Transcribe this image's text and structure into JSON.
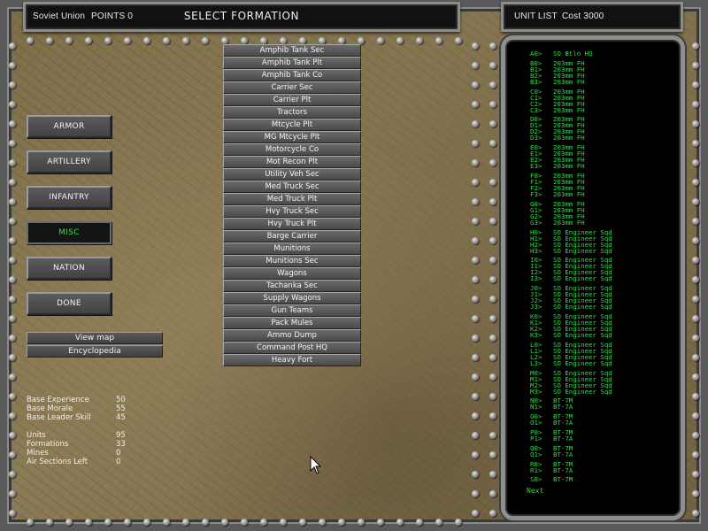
{
  "header": {
    "nation": "Soviet Union",
    "points_label": "POINTS 0",
    "title": "SELECT FORMATION",
    "unit_list_label": "UNIT LIST",
    "cost_label": "Cost 3000"
  },
  "menu": {
    "armor": "ARMOR",
    "artillery": "ARTILLERY",
    "infantry": "INFANTRY",
    "misc": "MISC",
    "nation": "NATION",
    "done": "DONE",
    "view_map": "View map",
    "encyclopedia": "Encyclopedia"
  },
  "formations": [
    "Amphib Tank Sec",
    "Amphib Tank Plt",
    "Amphib Tank Co",
    "Carrier Sec",
    "Carrier Plt",
    "Tractors",
    "Mtcycle Plt",
    "MG Mtcycle Plt",
    "Motorcycle Co",
    "Mot Recon Plt",
    "Utility Veh Sec",
    "Med Truck Sec",
    "Med Truck Plt",
    "Hvy Truck Sec",
    "Hvy Truck Plt",
    "Barge Carrier",
    "Munitions",
    "Munitions Sec",
    "Wagons",
    "Tachanka Sec",
    "Supply Wagons",
    "Gun Teams",
    "Pack Mules",
    "Ammo Dump",
    "Command Post HQ",
    "Heavy Fort"
  ],
  "stats": {
    "base_experience_label": "Base Experience",
    "base_experience": "50",
    "base_morale_label": "Base Morale",
    "base_morale": "55",
    "base_leader_label": "Base Leader Skill",
    "base_leader": "45",
    "units_label": "Units",
    "units": "95",
    "formations_label": "Formations",
    "formations": "33",
    "mines_label": "Mines",
    "mines": "0",
    "air_label": "Air Sections Left",
    "air": "0"
  },
  "unit_groups": [
    [
      {
        "code": "A0>",
        "name": "SO Btln HQ"
      }
    ],
    [
      {
        "code": "B0>",
        "name": "203mm FH"
      },
      {
        "code": "B1>",
        "name": "203mm FH"
      },
      {
        "code": "B2>",
        "name": "203mm FH"
      },
      {
        "code": "B3>",
        "name": "203mm FH"
      }
    ],
    [
      {
        "code": "C0>",
        "name": "203mm FH"
      },
      {
        "code": "C1>",
        "name": "203mm FH"
      },
      {
        "code": "C2>",
        "name": "203mm FH"
      },
      {
        "code": "C3>",
        "name": "203mm FH"
      }
    ],
    [
      {
        "code": "D0>",
        "name": "203mm FH"
      },
      {
        "code": "D1>",
        "name": "203mm FH"
      },
      {
        "code": "D2>",
        "name": "203mm FH"
      },
      {
        "code": "D3>",
        "name": "203mm FH"
      }
    ],
    [
      {
        "code": "E0>",
        "name": "203mm FH"
      },
      {
        "code": "E1>",
        "name": "203mm FH"
      },
      {
        "code": "E2>",
        "name": "203mm FH"
      },
      {
        "code": "E3>",
        "name": "203mm FH"
      }
    ],
    [
      {
        "code": "F0>",
        "name": "203mm FH"
      },
      {
        "code": "F1>",
        "name": "203mm FH"
      },
      {
        "code": "F2>",
        "name": "203mm FH"
      },
      {
        "code": "F3>",
        "name": "203mm FH"
      }
    ],
    [
      {
        "code": "G0>",
        "name": "203mm FH"
      },
      {
        "code": "G1>",
        "name": "203mm FH"
      },
      {
        "code": "G2>",
        "name": "203mm FH"
      },
      {
        "code": "G3>",
        "name": "203mm FH"
      }
    ],
    [
      {
        "code": "H0>",
        "name": "SO Engineer Sqd"
      },
      {
        "code": "H1>",
        "name": "SO Engineer Sqd"
      },
      {
        "code": "H2>",
        "name": "SO Engineer Sqd"
      },
      {
        "code": "H3>",
        "name": "SO Engineer Sqd"
      }
    ],
    [
      {
        "code": "I0>",
        "name": "SO Engineer Sqd"
      },
      {
        "code": "I1>",
        "name": "SO Engineer Sqd"
      },
      {
        "code": "I2>",
        "name": "SO Engineer Sqd"
      },
      {
        "code": "I3>",
        "name": "SO Engineer Sqd"
      }
    ],
    [
      {
        "code": "J0>",
        "name": "SO Engineer Sqd"
      },
      {
        "code": "J1>",
        "name": "SO Engineer Sqd"
      },
      {
        "code": "J2>",
        "name": "SO Engineer Sqd"
      },
      {
        "code": "J3>",
        "name": "SO Engineer Sqd"
      }
    ],
    [
      {
        "code": "K0>",
        "name": "SO Engineer Sqd"
      },
      {
        "code": "K1>",
        "name": "SO Engineer Sqd"
      },
      {
        "code": "K2>",
        "name": "SO Engineer Sqd"
      },
      {
        "code": "K3>",
        "name": "SO Engineer Sqd"
      }
    ],
    [
      {
        "code": "L0>",
        "name": "SO Engineer Sqd"
      },
      {
        "code": "L1>",
        "name": "SO Engineer Sqd"
      },
      {
        "code": "L2>",
        "name": "SO Engineer Sqd"
      },
      {
        "code": "L3>",
        "name": "SO Engineer Sqd"
      }
    ],
    [
      {
        "code": "M0>",
        "name": "SO Engineer Sqd"
      },
      {
        "code": "M1>",
        "name": "SO Engineer Sqd"
      },
      {
        "code": "M2>",
        "name": "SO Engineer Sqd"
      },
      {
        "code": "M3>",
        "name": "SO Engineer Sqd"
      }
    ],
    [
      {
        "code": "N0>",
        "name": "BT-7M"
      },
      {
        "code": "N1>",
        "name": "BT-7A"
      }
    ],
    [
      {
        "code": "O0>",
        "name": "BT-7M"
      },
      {
        "code": "O1>",
        "name": "BT-7A"
      }
    ],
    [
      {
        "code": "P0>",
        "name": "BT-7M"
      },
      {
        "code": "P1>",
        "name": "BT-7A"
      }
    ],
    [
      {
        "code": "Q0>",
        "name": "BT-7M"
      },
      {
        "code": "Q1>",
        "name": "BT-7A"
      }
    ],
    [
      {
        "code": "R0>",
        "name": "BT-7M"
      },
      {
        "code": "R1>",
        "name": "BT-7A"
      }
    ],
    [
      {
        "code": "S0>",
        "name": "BT-7M"
      }
    ]
  ],
  "next_label": "Next",
  "colors": {
    "accent_green": "#36d84a",
    "active_green": "#39e03a",
    "panel_black": "#000000",
    "button_gray": "#5b5b5b"
  }
}
